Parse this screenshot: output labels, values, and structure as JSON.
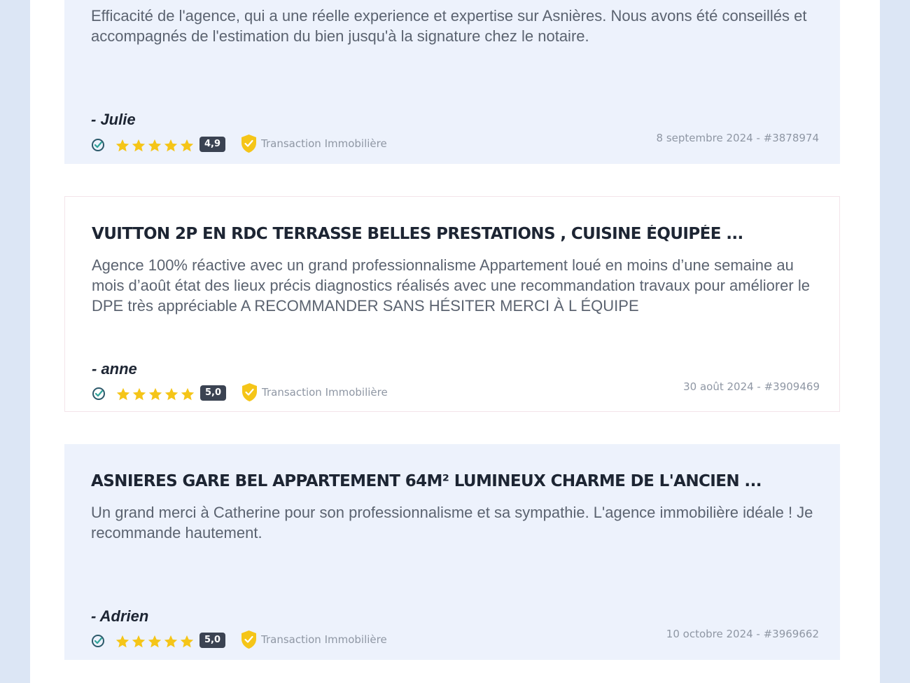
{
  "reviews": [
    {
      "title": "",
      "text": "Efficacité de l'agence, qui a une réelle experience et expertise sur Asnières. Nous avons été conseillés et accompagnés de l'estimation du bien jusqu'à la signature chez le notaire.",
      "author": "- Julie",
      "rating": "4,9",
      "category": "Transaction Immobilière",
      "date": "8 septembre 2024 - #3878974"
    },
    {
      "title": "VUITTON 2P EN RDC TERRASSE BELLES PRESTATIONS , CUISINE ÉQUIPÉE ...",
      "text": "Agence 100% réactive avec un grand professionnalisme Appartement loué en moins d’une semaine au mois d’août état des lieux précis diagnostics réalisés avec une recommandation travaux pour améliorer le DPE très appréciable A RECOMMANDER SANS HÉSITER MERCI À L ÉQUIPE",
      "author": "- anne",
      "rating": "5,0",
      "category": "Transaction Immobilière",
      "date": "30 août 2024 - #3909469"
    },
    {
      "title": "ASNIERES GARE BEL APPARTEMENT 64M² LUMINEUX CHARME DE L'ANCIEN ...",
      "text": "Un grand merci à Catherine pour son professionnalisme et sa sympathie. L'agence immobilière idéale ! Je recommande hautement.",
      "author": "- Adrien",
      "rating": "5,0",
      "category": "Transaction Immobilière",
      "date": "10 octobre 2024 - #3969662"
    }
  ],
  "icons": {
    "verified": "check-circle-icon",
    "star": "star-icon",
    "badge": "shield-check-icon"
  },
  "colors": {
    "star": "#f5c518",
    "shield": "#f5c518",
    "verified": "#2d5a6b",
    "score_bg": "#3b4352",
    "card_bg": "#edf2fc"
  }
}
